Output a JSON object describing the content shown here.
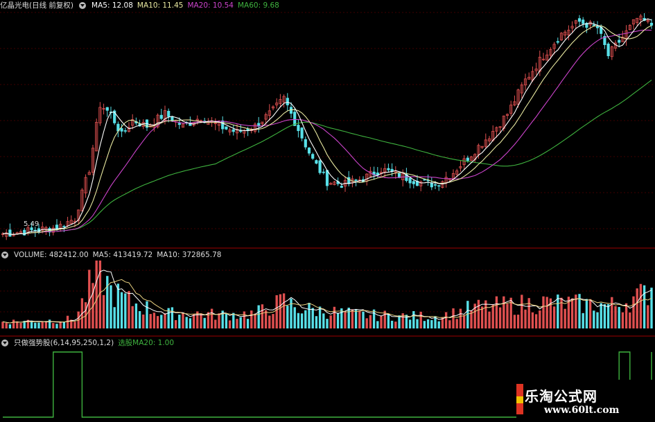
{
  "header": {
    "title": "亿晶光电(日线 前复权)",
    "ma5": "MA5: 12.08",
    "ma10": "MA10: 11.45",
    "ma20": "MA20: 10.54",
    "ma60": "MA60: 9.68"
  },
  "volume_header": {
    "label": "VOLUME: 482412.00",
    "ma5": "MA5: 413419.72",
    "ma10": "MA10: 372865.78"
  },
  "indicator_header": {
    "name": "只做强势股(6,14,95,250,1,2)",
    "value_label": "选股MA20: 1.00"
  },
  "price_annotation": "5.49",
  "watermark": {
    "site": "乐淘公式网",
    "url": "www.60lt.com"
  },
  "colors": {
    "up": "#e05050",
    "down": "#58e0e8",
    "ma5": "#ffffff",
    "ma10": "#e8e8a0",
    "ma20": "#cc44cc",
    "ma60": "#3fb33f",
    "volume_ma5": "#ffffff",
    "volume_ma10": "#e8d080",
    "signal": "#3fb33f",
    "grid": "#800000"
  },
  "chart_data": {
    "type": "candlestick",
    "panels": [
      "price",
      "volume",
      "signal"
    ],
    "price_anchors": [
      [
        0,
        5.4
      ],
      [
        8,
        5.5
      ],
      [
        15,
        5.6
      ],
      [
        20,
        5.9
      ],
      [
        24,
        7.5
      ],
      [
        27,
        9.6
      ],
      [
        30,
        9.3
      ],
      [
        33,
        8.6
      ],
      [
        36,
        9.1
      ],
      [
        40,
        8.9
      ],
      [
        45,
        9.3
      ],
      [
        50,
        8.9
      ],
      [
        55,
        9.2
      ],
      [
        60,
        8.9
      ],
      [
        65,
        8.7
      ],
      [
        70,
        8.9
      ],
      [
        75,
        9.4
      ],
      [
        78,
        9.8
      ],
      [
        82,
        8.8
      ],
      [
        86,
        7.8
      ],
      [
        90,
        7.1
      ],
      [
        95,
        7.0
      ],
      [
        100,
        7.2
      ],
      [
        105,
        7.5
      ],
      [
        110,
        7.3
      ],
      [
        115,
        7.1
      ],
      [
        120,
        7.0
      ],
      [
        125,
        7.4
      ],
      [
        130,
        8.0
      ],
      [
        135,
        8.6
      ],
      [
        140,
        9.3
      ],
      [
        145,
        10.4
      ],
      [
        150,
        11.2
      ],
      [
        155,
        11.9
      ],
      [
        160,
        12.3
      ],
      [
        165,
        12.1
      ],
      [
        168,
        11.2
      ],
      [
        172,
        11.8
      ],
      [
        176,
        12.4
      ],
      [
        180,
        12.2
      ]
    ],
    "volume_anchors": [
      [
        0,
        0.1
      ],
      [
        15,
        0.12
      ],
      [
        20,
        0.14
      ],
      [
        24,
        0.6
      ],
      [
        27,
        0.85
      ],
      [
        30,
        0.55
      ],
      [
        35,
        0.4
      ],
      [
        40,
        0.3
      ],
      [
        45,
        0.22
      ],
      [
        50,
        0.22
      ],
      [
        55,
        0.22
      ],
      [
        60,
        0.2
      ],
      [
        70,
        0.22
      ],
      [
        78,
        0.4
      ],
      [
        82,
        0.3
      ],
      [
        90,
        0.25
      ],
      [
        100,
        0.2
      ],
      [
        110,
        0.18
      ],
      [
        120,
        0.18
      ],
      [
        125,
        0.22
      ],
      [
        130,
        0.3
      ],
      [
        140,
        0.34
      ],
      [
        150,
        0.38
      ],
      [
        160,
        0.36
      ],
      [
        170,
        0.34
      ],
      [
        178,
        0.5
      ],
      [
        180,
        0.62
      ]
    ],
    "signal_anchors": [
      [
        0,
        0
      ],
      [
        13,
        0
      ],
      [
        14,
        1
      ],
      [
        21,
        1
      ],
      [
        22,
        0
      ],
      [
        170,
        0
      ],
      [
        171,
        1
      ],
      [
        173,
        1
      ],
      [
        174,
        0
      ],
      [
        179,
        0
      ],
      [
        180,
        1
      ]
    ],
    "moving_averages": [
      "MA5",
      "MA10",
      "MA20",
      "MA60"
    ]
  }
}
